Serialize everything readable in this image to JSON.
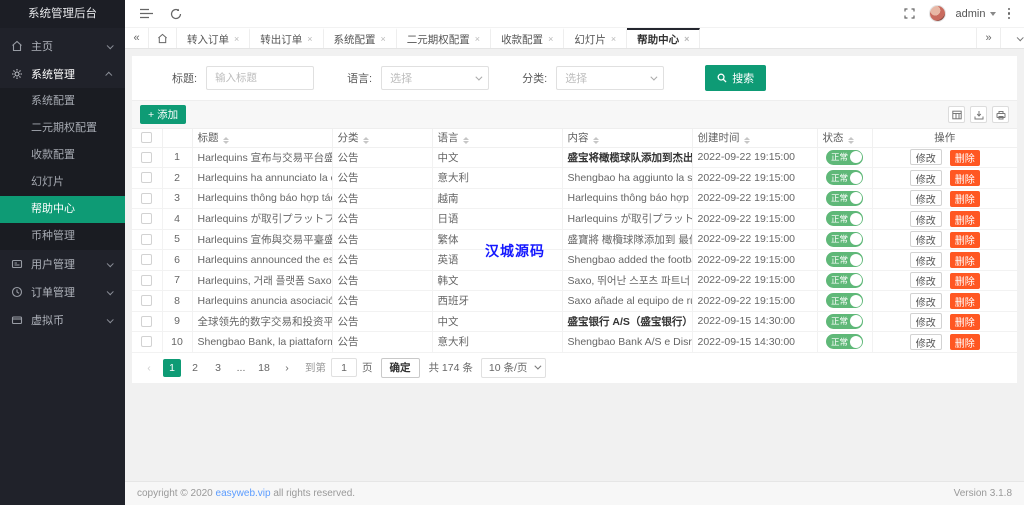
{
  "app": {
    "title": "系统管理后台"
  },
  "sidebar": {
    "items": [
      {
        "label": "主页",
        "icon": "home-icon"
      },
      {
        "label": "系统管理",
        "icon": "gear-icon",
        "expanded": true
      },
      {
        "label": "用户管理",
        "icon": "id-card-icon"
      },
      {
        "label": "订单管理",
        "icon": "clock-icon"
      },
      {
        "label": "虚拟币",
        "icon": "wallet-icon"
      }
    ],
    "submenu": [
      {
        "label": "系统配置"
      },
      {
        "label": "二元期权配置"
      },
      {
        "label": "收款配置"
      },
      {
        "label": "幻灯片"
      },
      {
        "label": "帮助中心",
        "active": true
      },
      {
        "label": "币种管理"
      }
    ]
  },
  "navbar": {
    "username": "admin"
  },
  "tabbar": {
    "back_arrow": "«",
    "forward_arrow": "»",
    "tabs": [
      {
        "label": "转入订单",
        "close": "×"
      },
      {
        "label": "转出订单",
        "close": "×"
      },
      {
        "label": "系统配置",
        "close": "×"
      },
      {
        "label": "二元期权配置",
        "close": "×"
      },
      {
        "label": "收款配置",
        "close": "×"
      },
      {
        "label": "幻灯片",
        "close": "×"
      },
      {
        "label": "帮助中心",
        "close": "×",
        "active": true
      }
    ]
  },
  "filters": {
    "title_label": "标题:",
    "title_placeholder": "输入标题",
    "language_label": "语言:",
    "language_placeholder": "选择",
    "category_label": "分类:",
    "category_placeholder": "选择",
    "search_label": "搜索"
  },
  "toolbar": {
    "add_label": "添加",
    "add_plus": "+"
  },
  "table": {
    "columns": {
      "title": "标题",
      "category": "分类",
      "language": "语言",
      "content": "内容",
      "created": "创建时间",
      "status": "状态",
      "ops": "操作"
    },
    "ops": {
      "edit": "修改",
      "delete": "删除"
    },
    "rows": [
      {
        "index": "1",
        "title": "Harlequins 宣布与交易平台盛...",
        "category": "公告",
        "language": "中文",
        "content": "盛宝将橄榄球队添加到杰出的",
        "content_bold": true,
        "created": "2022-09-22 19:15:00",
        "status": "正常"
      },
      {
        "index": "2",
        "title": "Harlequins ha annunciato la co...",
        "category": "公告",
        "language": "意大利",
        "content": "Shengbao ha aggiunto la squadra d",
        "created": "2022-09-22 19:15:00",
        "status": "正常"
      },
      {
        "index": "3",
        "title": "Harlequins thông báo hợp tác ...",
        "category": "公告",
        "language": "越南",
        "content": "Harlequins thông báo hợp tác với sà",
        "created": "2022-09-22 19:15:00",
        "status": "正常"
      },
      {
        "index": "4",
        "title": "Harlequins が取引プラットフ...",
        "category": "公告",
        "language": "日语",
        "content": "Harlequins が取引プラットフォーム",
        "created": "2022-09-22 19:15:00",
        "status": "正常"
      },
      {
        "index": "5",
        "title": "Harlequins 宣佈與交易平臺盛...",
        "category": "公告",
        "language": "繁体",
        "content": "盛寶將 橄欖球隊添加到 最佳體育合",
        "created": "2022-09-22 19:15:00",
        "status": "正常"
      },
      {
        "index": "6",
        "title": "Harlequins announced the est...",
        "category": "公告",
        "language": "英语",
        "content": "Shengbao added the football team t",
        "created": "2022-09-22 19:15:00",
        "status": "正常"
      },
      {
        "index": "7",
        "title": "Harlequins, 거래 플랫폼 Saxo...",
        "category": "公告",
        "language": "韩文",
        "content": "Saxo, 뛰어난 스포츠 파트너 목록에",
        "created": "2022-09-22 19:15:00",
        "status": "正常"
      },
      {
        "index": "8",
        "title": "Harlequins anuncia asociación...",
        "category": "公告",
        "language": "西班牙",
        "content": "Saxo añade al equipo de rugby a la",
        "created": "2022-09-22 19:15:00",
        "status": "正常"
      },
      {
        "index": "9",
        "title": "全球领先的数字交易和投资平...",
        "category": "公告",
        "language": "中文",
        "content": "盛宝银行 A/S（盛宝银行）和 Disru",
        "content_bold": true,
        "created": "2022-09-15 14:30:00",
        "status": "正常"
      },
      {
        "index": "10",
        "title": "Shengbao Bank, la piattaforma...",
        "category": "公告",
        "language": "意大利",
        "content": "Shengbao Bank A/S e Disruptive Ca",
        "created": "2022-09-15 14:30:00",
        "status": "正常"
      }
    ]
  },
  "pagination": {
    "prev": "‹",
    "next": "›",
    "pages": [
      {
        "label": "1",
        "active": true
      },
      {
        "label": "2"
      },
      {
        "label": "3"
      },
      {
        "label": "..."
      },
      {
        "label": "18"
      }
    ],
    "jump_prefix": "到第",
    "jump_value": "1",
    "jump_suffix": "页",
    "confirm": "确定",
    "total": "共 174 条",
    "page_size": "10 条/页"
  },
  "watermark": "汉城源码",
  "footer": {
    "copyright_prefix": "copyright © 2020 ",
    "link": "easyweb.vip",
    "copyright_suffix": " all rights reserved.",
    "version": "Version 3.1.8"
  },
  "colors": {
    "accent_green": "#0E9B75",
    "toggle_green": "#5FB878",
    "danger_orange": "#FF5722",
    "watermark_blue": "#1518FF",
    "link_blue": "#5B9CFF",
    "sidebar_dark": "#20222A"
  }
}
